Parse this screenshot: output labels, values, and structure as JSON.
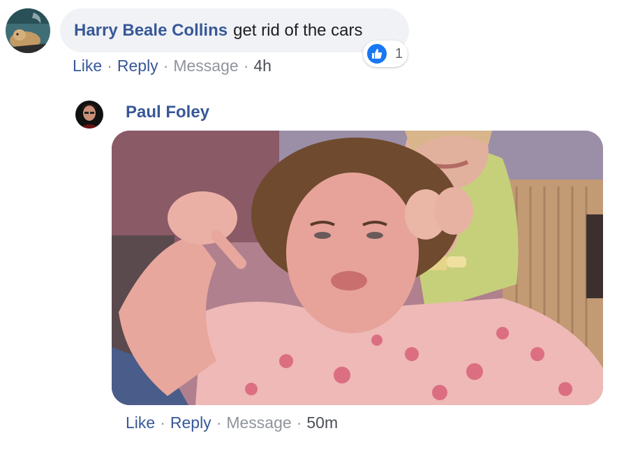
{
  "comment": {
    "author": "Harry Beale Collins",
    "text": "get rid of the cars",
    "reaction": {
      "icon": "thumbs-up-icon",
      "count": "1",
      "color": "#1877f2"
    },
    "actions": {
      "like": "Like",
      "reply": "Reply",
      "message": "Message",
      "time": "4h"
    }
  },
  "reply": {
    "author": "Paul Foley",
    "media": "gif",
    "actions": {
      "like": "Like",
      "reply": "Reply",
      "message": "Message",
      "time": "50m"
    }
  },
  "colors": {
    "link": "#385898",
    "muted": "#90949c",
    "bubble": "#f0f2f5",
    "like_blue": "#1877f2"
  }
}
